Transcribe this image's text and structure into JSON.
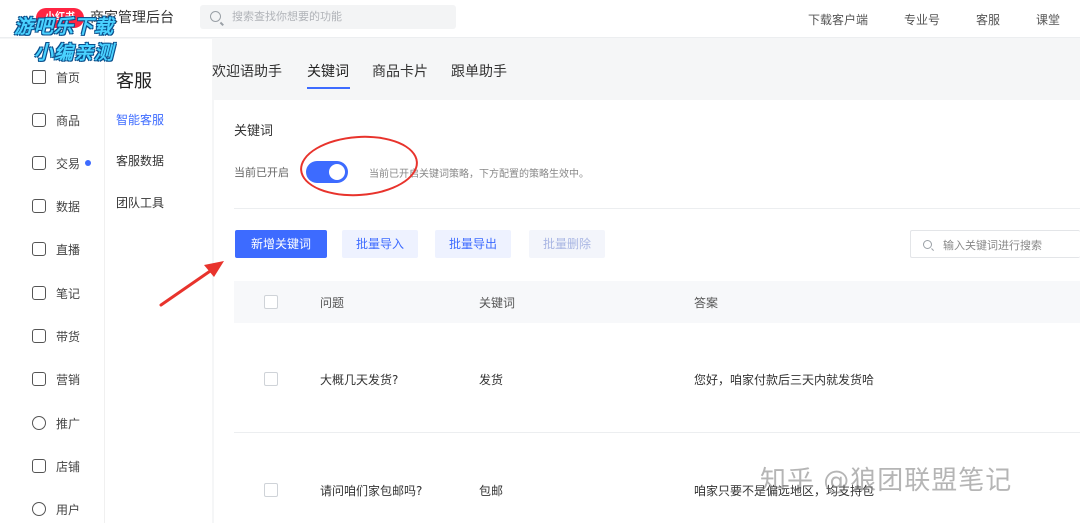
{
  "watermark": {
    "line1": "游吧乐下载",
    "line2": "小编亲测",
    "zhihu": "知乎 @狼团联盟笔记"
  },
  "topbar": {
    "logo": "小红书",
    "title": "商家管理后台",
    "search_placeholder": "搜索查找你想要的功能",
    "links": [
      "下载客户端",
      "专业号",
      "客服",
      "课堂"
    ]
  },
  "leftnav": {
    "items": [
      {
        "label": "首页",
        "icon": "home-icon"
      },
      {
        "label": "商品",
        "icon": "goods-icon"
      },
      {
        "label": "交易",
        "icon": "order-icon",
        "dot": true
      },
      {
        "label": "数据",
        "icon": "chart-icon"
      },
      {
        "label": "直播",
        "icon": "live-icon"
      },
      {
        "label": "笔记",
        "icon": "book-icon"
      },
      {
        "label": "带货",
        "icon": "bag-icon"
      },
      {
        "label": "营销",
        "icon": "megaphone-icon"
      },
      {
        "label": "推广",
        "icon": "promote-icon"
      },
      {
        "label": "店铺",
        "icon": "store-icon"
      },
      {
        "label": "用户",
        "icon": "user-icon"
      }
    ]
  },
  "subnav": {
    "title": "客服",
    "items": [
      {
        "label": "智能客服",
        "active": true
      },
      {
        "label": "客服数据",
        "active": false
      },
      {
        "label": "团队工具",
        "active": false
      }
    ]
  },
  "tabs": [
    {
      "label": "欢迎语助手"
    },
    {
      "label": "关键词",
      "active": true
    },
    {
      "label": "商品卡片"
    },
    {
      "label": "跟单助手"
    }
  ],
  "panel": {
    "title": "关键词",
    "state_label": "当前已开启",
    "toggle_on": true,
    "toggle_desc": "当前已开启关键词策略，下方配置的策略生效中。",
    "buttons": {
      "add": "新增关键词",
      "import": "批量导入",
      "export": "批量导出",
      "delete": "批量删除"
    },
    "search_placeholder": "输入关键词进行搜索",
    "table": {
      "headers": [
        "问题",
        "关键词",
        "答案"
      ],
      "rows": [
        {
          "question": "大概几天发货?",
          "keyword": "发货",
          "answer": "您好，咱家付款后三天内就发货哈"
        },
        {
          "question": "请问咱们家包邮吗?",
          "keyword": "包邮",
          "answer": "咱家只要不是偏远地区，均支持包"
        }
      ]
    }
  },
  "colors": {
    "accent": "#3d6bff",
    "brand": "#ff2442",
    "annotation": "#e8332c"
  }
}
